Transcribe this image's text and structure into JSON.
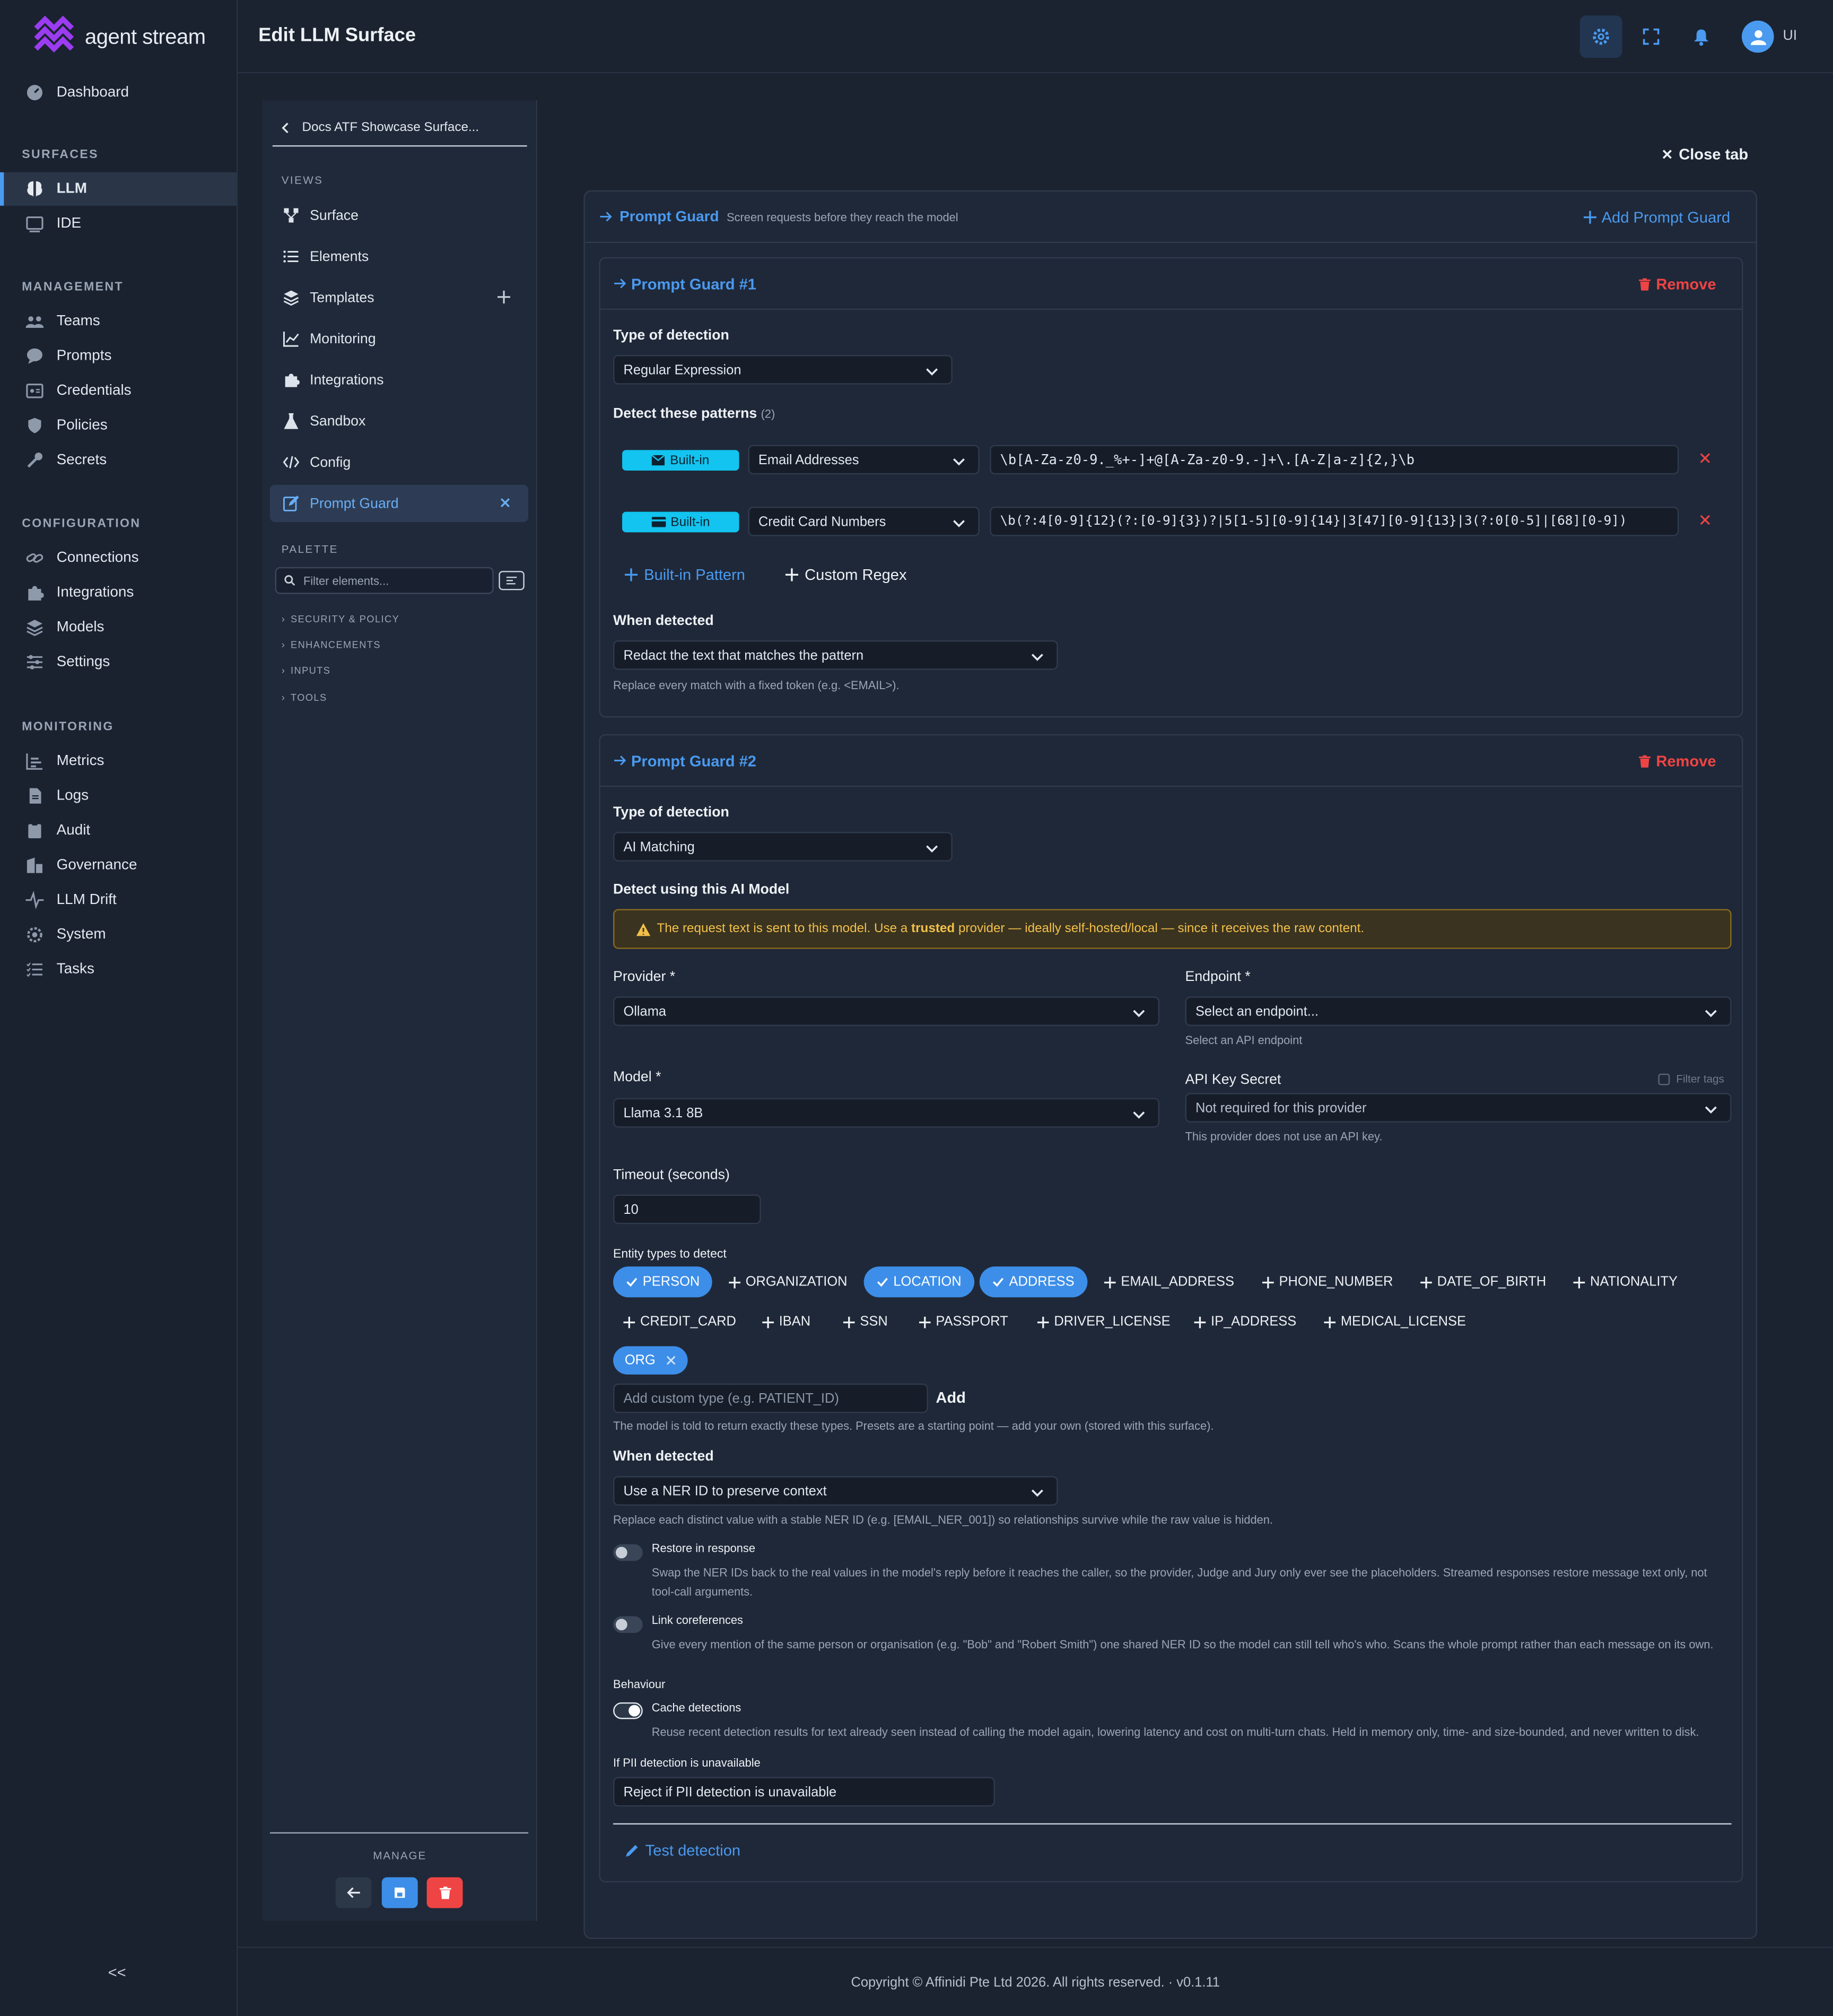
{
  "brand": {
    "name_a": "agent",
    "name_b": "stream"
  },
  "header": {
    "title": "Edit LLM Surface",
    "user": "UI"
  },
  "sidebar": {
    "dashboard": "Dashboard",
    "sections": {
      "surfaces": "SURFACES",
      "management": "MANAGEMENT",
      "configuration": "CONFIGURATION",
      "monitoring": "MONITORING"
    },
    "surfaces": [
      "LLM",
      "IDE"
    ],
    "management": [
      "Teams",
      "Prompts",
      "Credentials",
      "Policies",
      "Secrets"
    ],
    "configuration": [
      "Connections",
      "Integrations",
      "Models",
      "Settings"
    ],
    "monitoring": [
      "Metrics",
      "Logs",
      "Audit",
      "Governance",
      "LLM Drift",
      "System",
      "Tasks"
    ],
    "collapse": "<<"
  },
  "midpanel": {
    "back_label": "Docs ATF Showcase Surface...",
    "views_title": "VIEWS",
    "views": [
      "Surface",
      "Elements",
      "Templates",
      "Monitoring",
      "Integrations",
      "Sandbox",
      "Config",
      "Prompt Guard"
    ],
    "palette_title": "PALETTE",
    "filter_placeholder": "Filter elements...",
    "palette_items": [
      "SECURITY & POLICY",
      "ENHANCEMENTS",
      "INPUTS",
      "TOOLS"
    ],
    "manage_title": "MANAGE"
  },
  "main": {
    "close_tab": "Close tab",
    "section_title": "Prompt Guard",
    "section_subtitle": "Screen requests before they reach the model",
    "add_button": "Add Prompt Guard",
    "remove": "Remove",
    "guard1": {
      "title": "Prompt Guard #1",
      "type_label": "Type of detection",
      "type_value": "Regular Expression",
      "patterns_label": "Detect these patterns",
      "patterns_count": "(2)",
      "badge": "Built-in",
      "patterns": [
        {
          "name": "Email Addresses",
          "regex": "\\b[A-Za-z0-9._%+-]+@[A-Za-z0-9.-]+\\.[A-Z|a-z]{2,}\\b"
        },
        {
          "name": "Credit Card Numbers",
          "regex": "\\b(?:4[0-9]{12}(?:[0-9]{3})?|5[1-5][0-9]{14}|3[47][0-9]{13}|3(?:0[0-5]|[68][0-9])"
        }
      ],
      "add_builtin": "Built-in Pattern",
      "add_custom": "Custom Regex",
      "when_label": "When detected",
      "when_value": "Redact the text that matches the pattern",
      "when_hint": "Replace every match with a fixed token (e.g. <EMAIL>)."
    },
    "guard2": {
      "title": "Prompt Guard #2",
      "type_label": "Type of detection",
      "type_value": "AI Matching",
      "model_label": "Detect using this AI Model",
      "warn_pre": "The request text is sent to this model. Use a ",
      "warn_bold": "trusted",
      "warn_post": " provider — ideally self-hosted/local — since it receives the raw content.",
      "provider_label": "Provider *",
      "provider_value": "Ollama",
      "endpoint_label": "Endpoint *",
      "endpoint_value": "Select an endpoint...",
      "endpoint_hint": "Select an API endpoint",
      "model_field_label": "Model *",
      "model_value": "Llama 3.1 8B",
      "api_label": "API Key Secret",
      "filter_tags": "Filter tags",
      "api_value": "Not required for this provider",
      "api_hint": "This provider does not use an API key.",
      "timeout_label": "Timeout (seconds)",
      "timeout_value": "10",
      "entities_label": "Entity types to detect",
      "entities_row1": [
        {
          "name": "PERSON",
          "on": true
        },
        {
          "name": "ORGANIZATION",
          "on": false
        },
        {
          "name": "LOCATION",
          "on": true
        },
        {
          "name": "ADDRESS",
          "on": true
        },
        {
          "name": "EMAIL_ADDRESS",
          "on": false
        },
        {
          "name": "PHONE_NUMBER",
          "on": false
        },
        {
          "name": "DATE_OF_BIRTH",
          "on": false
        },
        {
          "name": "NATIONALITY",
          "on": false
        }
      ],
      "entities_row2": [
        "CREDIT_CARD",
        "IBAN",
        "SSN",
        "PASSPORT",
        "DRIVER_LICENSE",
        "IP_ADDRESS",
        "MEDICAL_LICENSE"
      ],
      "custom_tag": "ORG",
      "custom_placeholder": "Add custom type (e.g. PATIENT_ID)",
      "add": "Add",
      "entities_hint": "The model is told to return exactly these types. Presets are a starting point — add your own (stored with this surface).",
      "when_label": "When detected",
      "when_value": "Use a NER ID to preserve context",
      "when_hint": "Replace each distinct value with a stable NER ID (e.g. [EMAIL_NER_001]) so relationships survive while the raw value is hidden.",
      "restore_label": "Restore in response",
      "restore_desc": "Swap the NER IDs back to the real values in the model's reply before it reaches the caller, so the provider, Judge and Jury only ever see the placeholders. Streamed responses restore message text only, not tool-call arguments.",
      "coref_label": "Link coreferences",
      "coref_desc": "Give every mention of the same person or organisation (e.g. \"Bob\" and \"Robert Smith\") one shared NER ID so the model can still tell who's who. Scans the whole prompt rather than each message on its own.",
      "behaviour_label": "Behaviour",
      "cache_label": "Cache detections",
      "cache_desc": "Reuse recent detection results for text already seen instead of calling the model again, lowering latency and cost on multi-turn chats. Held in memory only, time- and size-bounded, and never written to disk.",
      "unavail_label": "If PII detection is unavailable",
      "unavail_value": "Reject if PII detection is unavailable",
      "test": "Test detection"
    }
  },
  "footer": "Copyright © Affinidi Pte Ltd 2026. All rights reserved. · v0.1.11"
}
